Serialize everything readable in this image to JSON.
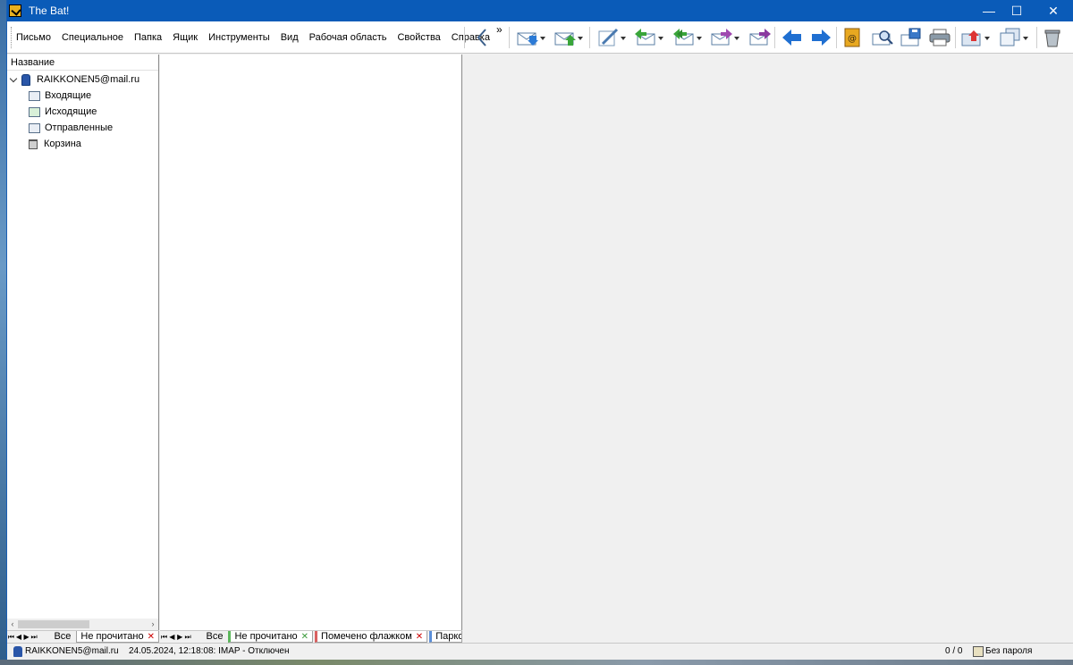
{
  "window": {
    "title": "The Bat!"
  },
  "window_controls": {
    "minimize": "—",
    "maximize": "☐",
    "close": "✕"
  },
  "menu": [
    "Письмо",
    "Специальное",
    "Папка",
    "Ящик",
    "Инструменты",
    "Вид",
    "Рабочая область",
    "Свойства",
    "Справка"
  ],
  "toolbar": {
    "overflow_label": "»",
    "icons": [
      "back-chevron-icon",
      "get-mail-icon",
      "send-mail-icon",
      "new-message-icon",
      "reply-icon",
      "reply-all-icon",
      "forward-icon",
      "redirect-icon",
      "previous-icon",
      "next-icon",
      "address-book-icon",
      "find-icon",
      "save-icon",
      "print-icon",
      "move-to-folder-icon",
      "copy-to-folder-icon",
      "delete-icon"
    ]
  },
  "folders": {
    "header": "Название",
    "account": "RAIKKONEN5@mail.ru",
    "items": [
      {
        "label": "Входящие",
        "icon": "inbox-folder-icon",
        "selected": true
      },
      {
        "label": "Исходящие",
        "icon": "outbox-folder-icon",
        "selected": false
      },
      {
        "label": "Отправленные",
        "icon": "sent-folder-icon",
        "selected": false
      },
      {
        "label": "Корзина",
        "icon": "trash-folder-icon",
        "selected": false
      }
    ],
    "tabs": [
      "Все",
      "Не прочитано"
    ]
  },
  "message_tabs": [
    {
      "label": "Все",
      "closable": false
    },
    {
      "label": "Не прочитано",
      "closable": true
    },
    {
      "label": "Помечено флажком",
      "closable": true
    },
    {
      "label": "Парков",
      "closable": false
    }
  ],
  "status": {
    "account": "RAIKKONEN5@mail.ru",
    "log": "24.05.2024, 12:18:08: IMAP  - Отключен",
    "counter": "0 / 0",
    "password": "Без пароля"
  },
  "colors": {
    "titlebar": "#0a5bb8",
    "selection": "#0078d7"
  }
}
